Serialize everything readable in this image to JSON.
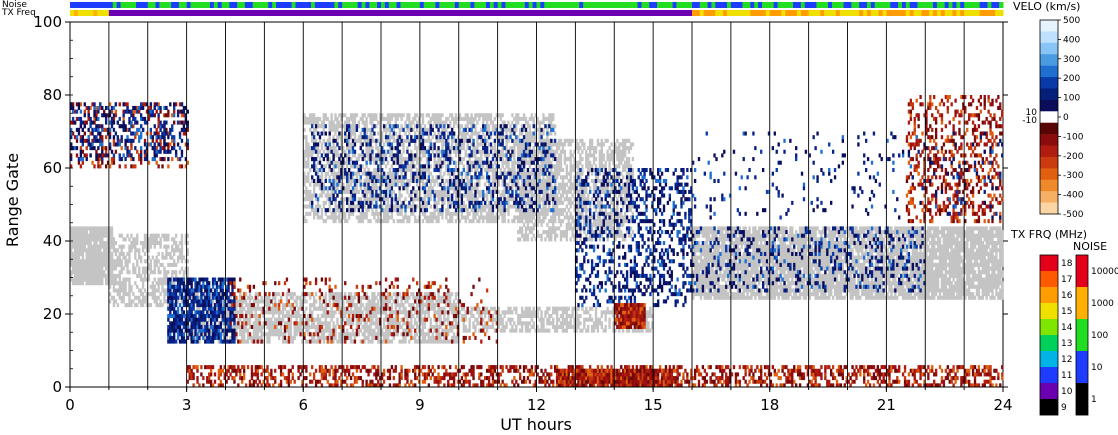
{
  "chart_data": {
    "type": "heatmap",
    "xlabel": "UT hours",
    "ylabel": "Range Gate",
    "xlim": [
      0,
      24
    ],
    "ylim": [
      0,
      100
    ],
    "x_ticks": [
      "0",
      "3",
      "6",
      "9",
      "12",
      "15",
      "18",
      "21",
      "24"
    ],
    "y_ticks": [
      "0",
      "20",
      "40",
      "60",
      "80",
      "100"
    ],
    "vertical_lines_hours": [
      1,
      2,
      3,
      4,
      5,
      6,
      7,
      8,
      9,
      10,
      11,
      12,
      13,
      14,
      15,
      16,
      17,
      18,
      19,
      20,
      21,
      22,
      23
    ],
    "top_bars": {
      "noise_label": "Noise",
      "txfreq_label": "TX Freq"
    },
    "velocity_colorbar": {
      "title": "VELO (km/s)",
      "ticks": [
        "500",
        "400",
        "300",
        "200",
        "100",
        "0",
        "-100",
        "-200",
        "-300",
        "-400",
        "-500"
      ],
      "side_ticks": [
        "10",
        "-10"
      ],
      "colors": [
        "#e6f4ff",
        "#bfe0ff",
        "#88c4f5",
        "#4a9be0",
        "#1f6fd0",
        "#0a3aa8",
        "#05207a",
        "#0b0d5a",
        "#ffffff",
        "#5a0505",
        "#8a0c0c",
        "#b01d10",
        "#cc3a10",
        "#e06010",
        "#ef8a2a",
        "#f6b064",
        "#fbd6a4"
      ]
    },
    "txfreq_colorbar": {
      "title": "TX FRQ (MHz)",
      "ticks": [
        "18",
        "17",
        "16",
        "15",
        "14",
        "13",
        "12",
        "11",
        "10",
        "9"
      ],
      "colors": [
        "#e4001a",
        "#ff5a00",
        "#ff9c00",
        "#f0e000",
        "#7ee600",
        "#00d15a",
        "#00b4e6",
        "#1d3cff",
        "#6a00b0",
        "#000000"
      ]
    },
    "noise_colorbar": {
      "title": "NOISE",
      "ticks": [
        "10000",
        "1000",
        "100",
        "10",
        "1"
      ],
      "colors": [
        "#e4001a",
        "#ffb000",
        "#22dd22",
        "#1d3cff",
        "#000000"
      ]
    },
    "ground_scatter_color": "#c4c4c4",
    "bands": [
      {
        "name": "gs-early",
        "kind": "gs",
        "t0": 0.0,
        "t1": 1.1,
        "g0": 28,
        "g1": 44,
        "density": 0.95
      },
      {
        "name": "gs-e-region",
        "kind": "gs",
        "t0": 1.0,
        "t1": 3.0,
        "g0": 22,
        "g1": 42,
        "density": 0.55
      },
      {
        "name": "gs-main",
        "kind": "gs",
        "t0": 3.0,
        "t1": 10.0,
        "g0": 12,
        "g1": 26,
        "density": 0.7
      },
      {
        "name": "gs-after",
        "kind": "gs",
        "t0": 10.0,
        "t1": 15.0,
        "g0": 15,
        "g1": 22,
        "density": 0.6
      },
      {
        "name": "gs-late",
        "kind": "gs",
        "t0": 16.0,
        "t1": 24.0,
        "g0": 24,
        "g1": 44,
        "density": 0.85
      },
      {
        "name": "gs-arc",
        "kind": "gs",
        "t0": 6.0,
        "t1": 12.5,
        "g0": 45,
        "g1": 75,
        "density": 0.6
      },
      {
        "name": "gs-arc2",
        "kind": "gs",
        "t0": 11.5,
        "t1": 14.5,
        "g0": 40,
        "g1": 68,
        "density": 0.6
      },
      {
        "name": "neg-gate0",
        "kind": "neg",
        "t0": 3.0,
        "t1": 24.0,
        "g0": 0,
        "g1": 6,
        "density": 0.45
      },
      {
        "name": "neg-strong",
        "kind": "neg",
        "t0": 12.5,
        "t1": 15.5,
        "g0": 0,
        "g1": 5,
        "density": 0.95
      },
      {
        "name": "pos-main",
        "kind": "pos",
        "t0": 2.5,
        "t1": 4.2,
        "g0": 12,
        "g1": 30,
        "density": 0.75
      },
      {
        "name": "pos-arc",
        "kind": "pos",
        "t0": 6.2,
        "t1": 12.5,
        "g0": 48,
        "g1": 72,
        "density": 0.25
      },
      {
        "name": "pos-late",
        "kind": "pos",
        "t0": 16.0,
        "t1": 22.0,
        "g0": 26,
        "g1": 44,
        "density": 0.2
      },
      {
        "name": "pos-descent",
        "kind": "pos",
        "t0": 13.0,
        "t1": 16.0,
        "g0": 22,
        "g1": 60,
        "density": 0.3
      },
      {
        "name": "neg-upper-early",
        "kind": "neg",
        "t0": 0.0,
        "t1": 3.0,
        "g0": 60,
        "g1": 78,
        "density": 0.25
      },
      {
        "name": "pos-upper-early",
        "kind": "pos",
        "t0": 0.0,
        "t1": 3.0,
        "g0": 62,
        "g1": 78,
        "density": 0.3
      },
      {
        "name": "neg-upper-late",
        "kind": "neg",
        "t0": 21.5,
        "t1": 24.0,
        "g0": 45,
        "g1": 80,
        "density": 0.3
      },
      {
        "name": "neg-patch-14",
        "kind": "neg",
        "t0": 14.0,
        "t1": 14.8,
        "g0": 16,
        "g1": 23,
        "density": 0.95
      },
      {
        "name": "neg-scatter-mid",
        "kind": "neg",
        "t0": 4.0,
        "t1": 11.0,
        "g0": 12,
        "g1": 30,
        "density": 0.12
      },
      {
        "name": "pos-scatter-late",
        "kind": "pos",
        "t0": 16.0,
        "t1": 24.0,
        "g0": 46,
        "g1": 70,
        "density": 0.06
      }
    ]
  }
}
